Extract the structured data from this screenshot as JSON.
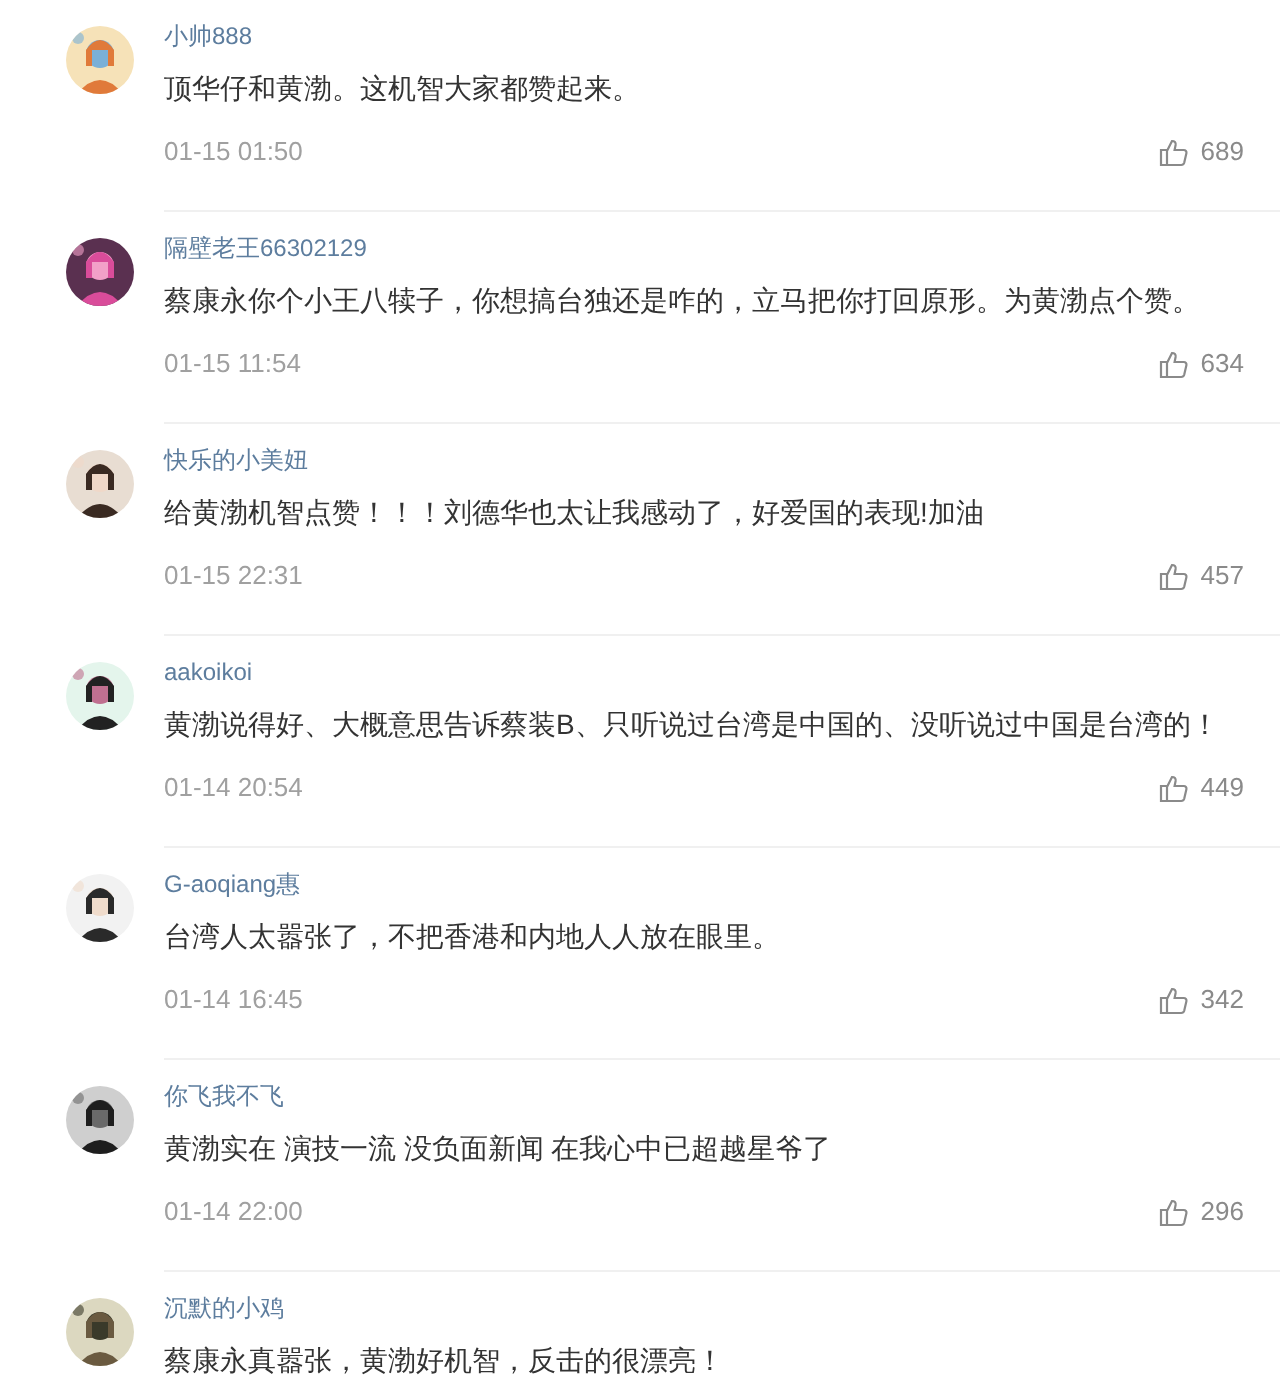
{
  "comments": [
    {
      "user": "小帅888",
      "text": "顶华仔和黄渤。这机智大家都赞起来。",
      "time": "01-15 01:50",
      "likes": "689"
    },
    {
      "user": "隔壁老王66302129",
      "text": "蔡康永你个小王八犊子，你想搞台独还是咋的，立马把你打回原形。为黄渤点个赞。",
      "time": "01-15 11:54",
      "likes": "634"
    },
    {
      "user": "快乐的小美妞",
      "text": "给黄渤机智点赞！！！刘德华也太让我感动了，好爱国的表现!加油",
      "time": "01-15 22:31",
      "likes": "457"
    },
    {
      "user": "aakoikoi",
      "text": "黄渤说得好、大概意思告诉蔡装B、只听说过台湾是中国的、没听说过中国是台湾的！",
      "time": "01-14 20:54",
      "likes": "449"
    },
    {
      "user": "G-aoqiang惠",
      "text": "台湾人太嚣张了，不把香港和内地人人放在眼里。",
      "time": "01-14 16:45",
      "likes": "342"
    },
    {
      "user": "你飞我不飞",
      "text": "黄渤实在 演技一流 没负面新闻 在我心中已超越星爷了",
      "time": "01-14 22:00",
      "likes": "296"
    },
    {
      "user": "沉默的小鸡",
      "text": "蔡康永真嚣张，黄渤好机智，反击的很漂亮！"
    }
  ]
}
